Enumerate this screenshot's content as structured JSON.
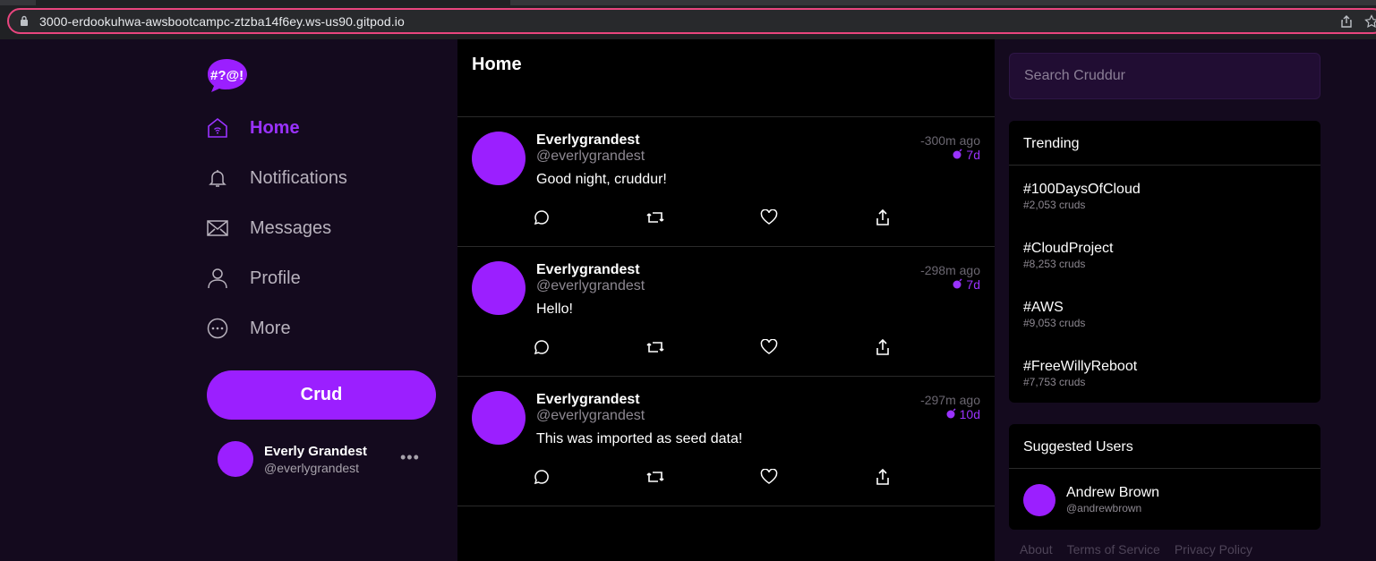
{
  "browser": {
    "url": "3000-erdookuhwa-awsbootcampc-ztzba14f6ey.ws-us90.gitpod.io"
  },
  "nav": {
    "logo_text": "#?@!",
    "items": [
      {
        "label": "Home",
        "icon": "home-icon",
        "active": true
      },
      {
        "label": "Notifications",
        "icon": "bell-icon",
        "active": false
      },
      {
        "label": "Messages",
        "icon": "envelope-icon",
        "active": false
      },
      {
        "label": "Profile",
        "icon": "person-icon",
        "active": false
      },
      {
        "label": "More",
        "icon": "more-circle-icon",
        "active": false
      }
    ],
    "crud_label": "Crud",
    "me": {
      "name": "Everly Grandest",
      "handle": "@everlygrandest",
      "menu": "•••"
    }
  },
  "feed": {
    "title": "Home",
    "posts": [
      {
        "display_name": "Everlygrandest",
        "handle": "@everlygrandest",
        "message": "Good night, cruddur!",
        "ago": "-300m ago",
        "expires": "7d"
      },
      {
        "display_name": "Everlygrandest",
        "handle": "@everlygrandest",
        "message": "Hello!",
        "ago": "-298m ago",
        "expires": "7d"
      },
      {
        "display_name": "Everlygrandest",
        "handle": "@everlygrandest",
        "message": "This was imported as seed data!",
        "ago": "-297m ago",
        "expires": "10d"
      }
    ]
  },
  "sidebar": {
    "search_placeholder": "Search Cruddur",
    "trending_title": "Trending",
    "trends": [
      {
        "tag": "#100DaysOfCloud",
        "count": "#2,053 cruds"
      },
      {
        "tag": "#CloudProject",
        "count": "#8,253 cruds"
      },
      {
        "tag": "#AWS",
        "count": "#9,053 cruds"
      },
      {
        "tag": "#FreeWillyReboot",
        "count": "#7,753 cruds"
      }
    ],
    "suggested_title": "Suggested Users",
    "suggested": {
      "name": "Andrew Brown",
      "handle": "@andrewbrown"
    },
    "footer": [
      "About",
      "Terms of Service",
      "Privacy Policy"
    ]
  },
  "colors": {
    "accent": "#9b1fff",
    "background": "#140a1e",
    "feed_bg": "#000000"
  }
}
